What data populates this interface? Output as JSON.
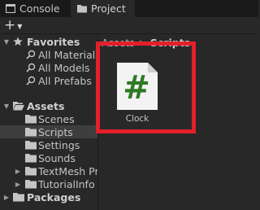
{
  "tabs": [
    {
      "label": "Console",
      "icon": "console-icon"
    },
    {
      "label": "Project",
      "icon": "folder-icon",
      "active": true
    }
  ],
  "toolbar": {
    "add_label": "+",
    "add_dropdown_icon": "caret-down-icon"
  },
  "tree": {
    "favorites": {
      "label": "Favorites",
      "items": [
        "All Materials",
        "All Models",
        "All Prefabs"
      ]
    },
    "assets": {
      "label": "Assets",
      "children": [
        "Scenes",
        "Scripts",
        "Settings",
        "Sounds",
        "TextMesh Pro",
        "TutorialInfo"
      ],
      "selected": "Scripts",
      "expandable": [
        "TextMesh Pro",
        "TutorialInfo"
      ]
    },
    "packages": {
      "label": "Packages"
    }
  },
  "breadcrumb": {
    "root": "Assets",
    "separator": ">",
    "current": "Scripts"
  },
  "asset": {
    "label": "Clock",
    "glyph": "#",
    "type": "csharp-script"
  },
  "colors": {
    "highlight": "#e3202a",
    "glyph": "#2e7b24",
    "background": "#282828",
    "tabbar": "#191919",
    "selected_row": "#3e3e3e"
  }
}
